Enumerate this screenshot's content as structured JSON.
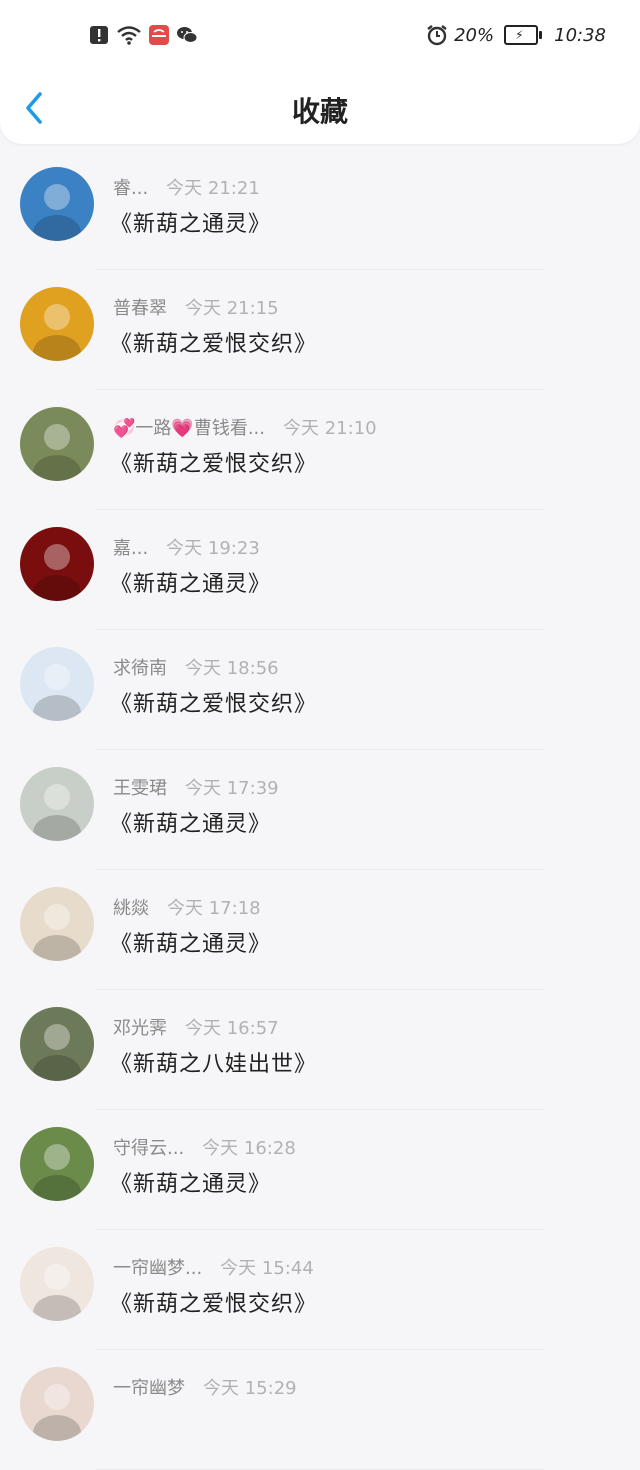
{
  "status_bar": {
    "battery_percent": "20%",
    "time": "10:38"
  },
  "nav": {
    "title": "收藏"
  },
  "items": [
    {
      "name": "睿...",
      "time": "今天 21:21",
      "work": "《新葫之通灵》",
      "avatar_color": "#3b82c4"
    },
    {
      "name": "普春翠",
      "time": "今天 21:15",
      "work": "《新葫之爱恨交织》",
      "avatar_color": "#e0a020"
    },
    {
      "name": "💞一路💗曹钱看...",
      "time": "今天 21:10",
      "work": "《新葫之爱恨交织》",
      "avatar_color": "#7a8a5a"
    },
    {
      "name": "嘉...",
      "time": "今天 19:23",
      "work": "《新葫之通灵》",
      "avatar_color": "#7a0e0e"
    },
    {
      "name": "求徛南",
      "time": "今天 18:56",
      "work": "《新葫之爱恨交织》",
      "avatar_color": "#dde7f3"
    },
    {
      "name": "王雯珺",
      "time": "今天 17:39",
      "work": "《新葫之通灵》",
      "avatar_color": "#c8cfc8"
    },
    {
      "name": "絩燚",
      "time": "今天 17:18",
      "work": "《新葫之通灵》",
      "avatar_color": "#e7dccb"
    },
    {
      "name": "邓光霁",
      "time": "今天 16:57",
      "work": "《新葫之八娃出世》",
      "avatar_color": "#6d7a5a"
    },
    {
      "name": "守得云...",
      "time": "今天 16:28",
      "work": "《新葫之通灵》",
      "avatar_color": "#6a8b4a"
    },
    {
      "name": "一帘幽梦...",
      "time": "今天 15:44",
      "work": "《新葫之爱恨交织》",
      "avatar_color": "#f0e6e0"
    },
    {
      "name": "一帘幽梦",
      "time": "今天 15:29",
      "work": "",
      "avatar_color": "#e8d8d0"
    }
  ]
}
